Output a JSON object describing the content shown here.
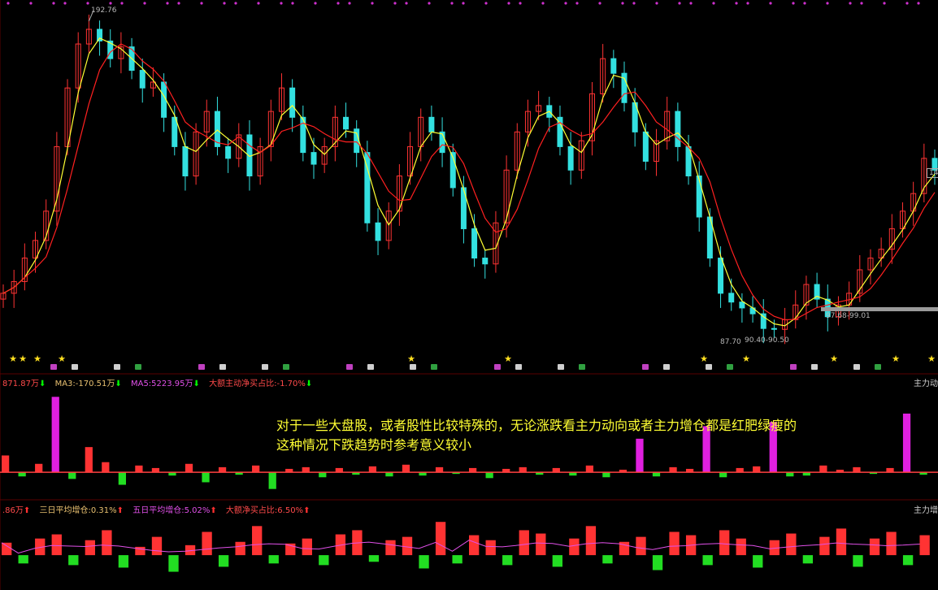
{
  "price_labels": {
    "high": "192.76",
    "low": "87.70",
    "range_a": "90.40-90.50",
    "range_b": "97.68-99.01",
    "right_cut": "14"
  },
  "panel2": {
    "legend": [
      {
        "text": "871.87万",
        "color": "#ff4a4a",
        "arrow": "⬇",
        "arrow_color": "#00ff00"
      },
      {
        "text": "MA3:-170.51万",
        "color": "#e8c070",
        "arrow": "⬇",
        "arrow_color": "#00ff00"
      },
      {
        "text": "MA5:5223.95万",
        "color": "#e050e8",
        "arrow": "⬇",
        "arrow_color": "#00ff00"
      },
      {
        "text": "大额主动净买占比:-1.70%",
        "color": "#ff4a4a",
        "arrow": "⬇",
        "arrow_color": "#00ff00"
      }
    ],
    "title_right": "主力动向"
  },
  "panel3": {
    "legend": [
      {
        "text": ".86万",
        "color": "#ff4a4a",
        "arrow": "⬆",
        "arrow_color": "#ff3030"
      },
      {
        "text": "三日平均增仓:0.31%",
        "color": "#e8c070",
        "arrow": "⬆",
        "arrow_color": "#ff3030"
      },
      {
        "text": "五日平均增仓:5.02%",
        "color": "#e050e8",
        "arrow": "⬆",
        "arrow_color": "#ff3030"
      },
      {
        "text": "大额净买占比:6.50%",
        "color": "#ff4a4a",
        "arrow": "⬆",
        "arrow_color": "#ff3030"
      }
    ],
    "title_right": "主力增"
  },
  "annotation": {
    "line1": "对于一些大盘股，或者股性比较特殊的，无论涨跌看主力动向或者主力增仓都是红肥绿瘦的",
    "line2": "这种情况下跌趋势时参考意义较小"
  },
  "colors": {
    "up": "#ff3333",
    "down": "#33e0e0",
    "special": "#e020e0",
    "ma_yellow": "#ffff33",
    "ma_red": "#ff2020",
    "star": "#ffe020"
  },
  "chart_data": [
    {
      "type": "line",
      "title": "",
      "series": [
        {
          "values": [
            100,
            104,
            112,
            118,
            128,
            150,
            170,
            185,
            190,
            186,
            180,
            184,
            176,
            170,
            172,
            160,
            150,
            140,
            155,
            162,
            150,
            146,
            154,
            140,
            150,
            162,
            170,
            160,
            148,
            144,
            150,
            160,
            156,
            148,
            124,
            118,
            128,
            140,
            150,
            160,
            155,
            148,
            136,
            122,
            112,
            110,
            124,
            142,
            155,
            162,
            164,
            160,
            150,
            142,
            152,
            168,
            180,
            175,
            165,
            155,
            145,
            152,
            162,
            150,
            140,
            126,
            112,
            100,
            97,
            95,
            93,
            88,
            87.7,
            91,
            96,
            103,
            98,
            92,
            96,
            100,
            108,
            112,
            115,
            122,
            128,
            134,
            146,
            142
          ]
        }
      ],
      "ylim": [
        85,
        195
      ],
      "markers": {
        "high": 192.76,
        "low": 87.7
      }
    },
    {
      "type": "bar",
      "title": "",
      "values": [
        20,
        -5,
        10,
        90,
        -8,
        30,
        12,
        -15,
        8,
        5,
        -4,
        10,
        -12,
        6,
        -3,
        8,
        -20,
        4,
        6,
        -6,
        5,
        -3,
        7,
        -5,
        9,
        -4,
        6,
        -2,
        5,
        -7,
        4,
        6,
        -3,
        5,
        -4,
        8,
        -6,
        3,
        40,
        -5,
        6,
        4,
        55,
        -6,
        5,
        7,
        60,
        -5,
        -4,
        8,
        3,
        6,
        -2,
        5,
        70,
        -3
      ],
      "ylim": [
        -30,
        100
      ]
    },
    {
      "type": "bar",
      "title": "",
      "values": [
        15,
        -10,
        20,
        25,
        -12,
        18,
        30,
        -15,
        10,
        22,
        -20,
        12,
        28,
        -14,
        16,
        35,
        -10,
        14,
        20,
        -12,
        25,
        30,
        -8,
        18,
        22,
        -16,
        40,
        -10,
        24,
        18,
        -12,
        30,
        26,
        -14,
        20,
        35,
        -10,
        16,
        22,
        -18,
        28,
        24,
        -12,
        30,
        20,
        -15,
        18,
        26,
        -10,
        22,
        32,
        -14,
        20,
        28,
        -12,
        24
      ],
      "ylim": [
        -40,
        50
      ]
    }
  ]
}
